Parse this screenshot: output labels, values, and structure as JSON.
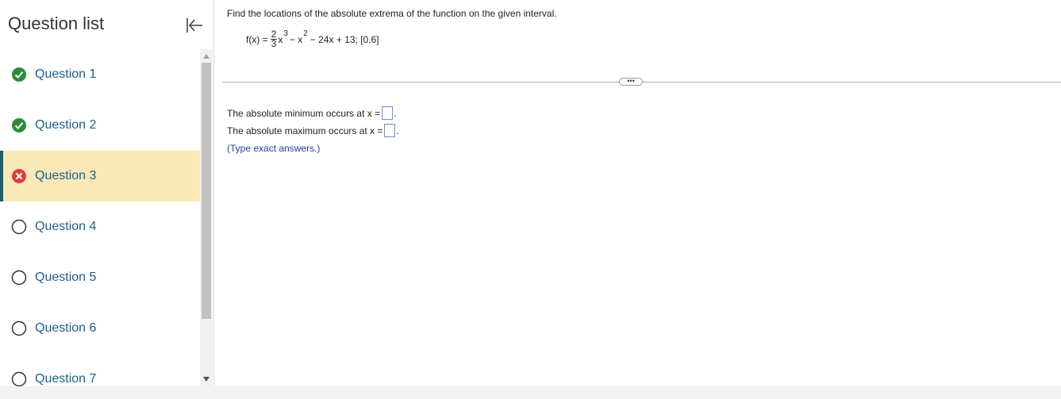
{
  "sidebar": {
    "title": "Question list",
    "collapse_icon": "collapse-left-icon",
    "questions": [
      {
        "label": "Question 1",
        "status": "correct"
      },
      {
        "label": "Question 2",
        "status": "correct"
      },
      {
        "label": "Question 3",
        "status": "incorrect",
        "current": true
      },
      {
        "label": "Question 4",
        "status": "unanswered"
      },
      {
        "label": "Question 5",
        "status": "unanswered"
      },
      {
        "label": "Question 6",
        "status": "unanswered"
      },
      {
        "label": "Question 7",
        "status": "unanswered"
      }
    ]
  },
  "problem": {
    "instruction": "Find the locations of the absolute extrema of the function on the given interval.",
    "formula": {
      "lhs": "f(x) =",
      "frac_num": "2",
      "frac_den": "3",
      "term1": "x",
      "exp1": "3",
      "minus1": "− x",
      "exp2": "2",
      "rest": "− 24x + 13; [0,6]"
    },
    "more_label": "•••",
    "answer_min": "The absolute minimum occurs at x =",
    "answer_max": "The absolute maximum occurs at x =",
    "answer_min_value": "",
    "answer_max_value": "",
    "period": ".",
    "hint": "(Type exact answers.)"
  },
  "colors": {
    "correct": "#2e8b3a",
    "incorrect": "#d9423a",
    "current_bg": "#f9e9b9",
    "accent": "#1a5d74",
    "link": "#1f5f8b"
  }
}
